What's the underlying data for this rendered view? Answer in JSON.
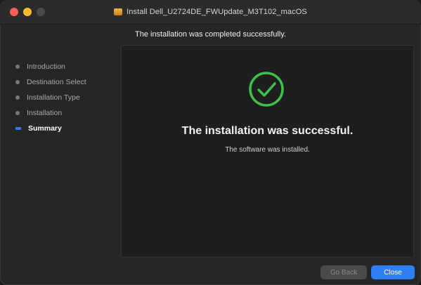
{
  "window": {
    "title": "Install Dell_U2724DE_FWUpdate_M3T102_macOS"
  },
  "header": {
    "subtitle": "The installation was completed successfully."
  },
  "sidebar": {
    "items": [
      {
        "label": "Introduction",
        "active": false
      },
      {
        "label": "Destination Select",
        "active": false
      },
      {
        "label": "Installation Type",
        "active": false
      },
      {
        "label": "Installation",
        "active": false
      },
      {
        "label": "Summary",
        "active": true
      }
    ]
  },
  "main": {
    "icon": "checkmark-circle-icon",
    "title": "The installation was successful.",
    "message": "The software was installed."
  },
  "buttons": {
    "go_back": "Go Back",
    "close": "Close"
  },
  "colors": {
    "success": "#3ec14a",
    "accent": "#2f7ff5",
    "active_step": "#3478f6"
  }
}
